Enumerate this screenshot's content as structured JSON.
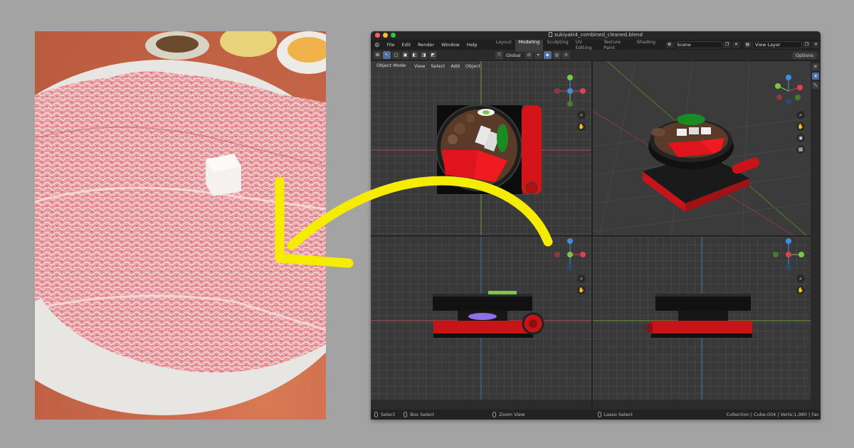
{
  "window": {
    "title": "sukiyaki4_combined_cleaned.blend"
  },
  "menu": [
    "File",
    "Edit",
    "Render",
    "Window",
    "Help"
  ],
  "workspace_tabs": [
    {
      "label": "Layout",
      "active": false
    },
    {
      "label": "Modeling",
      "active": true
    },
    {
      "label": "Sculpting",
      "active": false
    },
    {
      "label": "UV Editing",
      "active": false
    },
    {
      "label": "Texture Paint",
      "active": false
    },
    {
      "label": "Shading",
      "active": false
    }
  ],
  "scene": {
    "name": "Scene",
    "view_layer": "View Layer"
  },
  "toolbar": {
    "transform_orientation": "Global",
    "options_label": "Options"
  },
  "viewport_header": {
    "mode": "Object Mode",
    "menus": [
      "View",
      "Select",
      "Add",
      "Object"
    ]
  },
  "status_bar": {
    "select": "Select",
    "box_select": "Box Select",
    "zoom_view": "Zoom View",
    "lasso_select": "Lasso Select",
    "info": "Collection | Cube.004 | Verts:1,980 | Fac"
  },
  "gizmo_axes": {
    "x": "X",
    "y": "Y",
    "z": "Z"
  },
  "colors": {
    "arrow": "#f5ec00",
    "accent_blue": "#4a6fa0",
    "x_axis": "#e0404f",
    "y_axis": "#7ac943",
    "z_axis": "#3d8ee3"
  }
}
